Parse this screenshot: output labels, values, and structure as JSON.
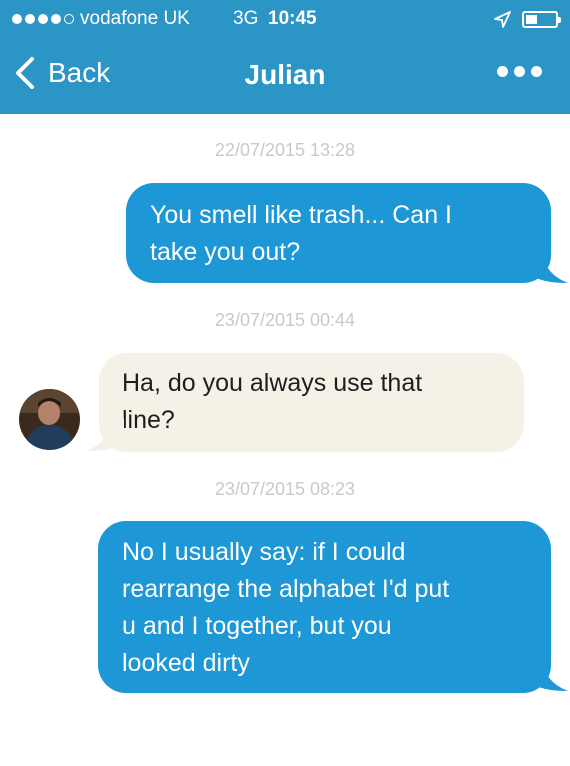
{
  "status_bar": {
    "carrier": "vodafone UK",
    "network": "3G",
    "time": "10:45",
    "signal_bars": 4,
    "signal_max": 5
  },
  "nav": {
    "back_label": "Back",
    "title": "Julian",
    "more_icon": "more-dots-icon"
  },
  "messages": [
    {
      "timestamp": "22/07/2015 13:28",
      "direction": "outgoing",
      "lines": [
        "You smell like trash... Can I",
        "take you out?"
      ]
    },
    {
      "timestamp": "23/07/2015 00:44",
      "direction": "incoming",
      "lines": [
        "Ha, do you always use that",
        "line?"
      ]
    },
    {
      "timestamp": "23/07/2015 08:23",
      "direction": "outgoing",
      "lines": [
        "No I usually say: if I could",
        "rearrange the alphabet I'd put",
        "u and I together, but you",
        "looked dirty"
      ]
    }
  ],
  "colors": {
    "header": "#2b95c6",
    "outgoing_bubble": "#1d97d6",
    "incoming_bubble": "#f5f1e7",
    "timestamp": "#c9c9c9"
  }
}
